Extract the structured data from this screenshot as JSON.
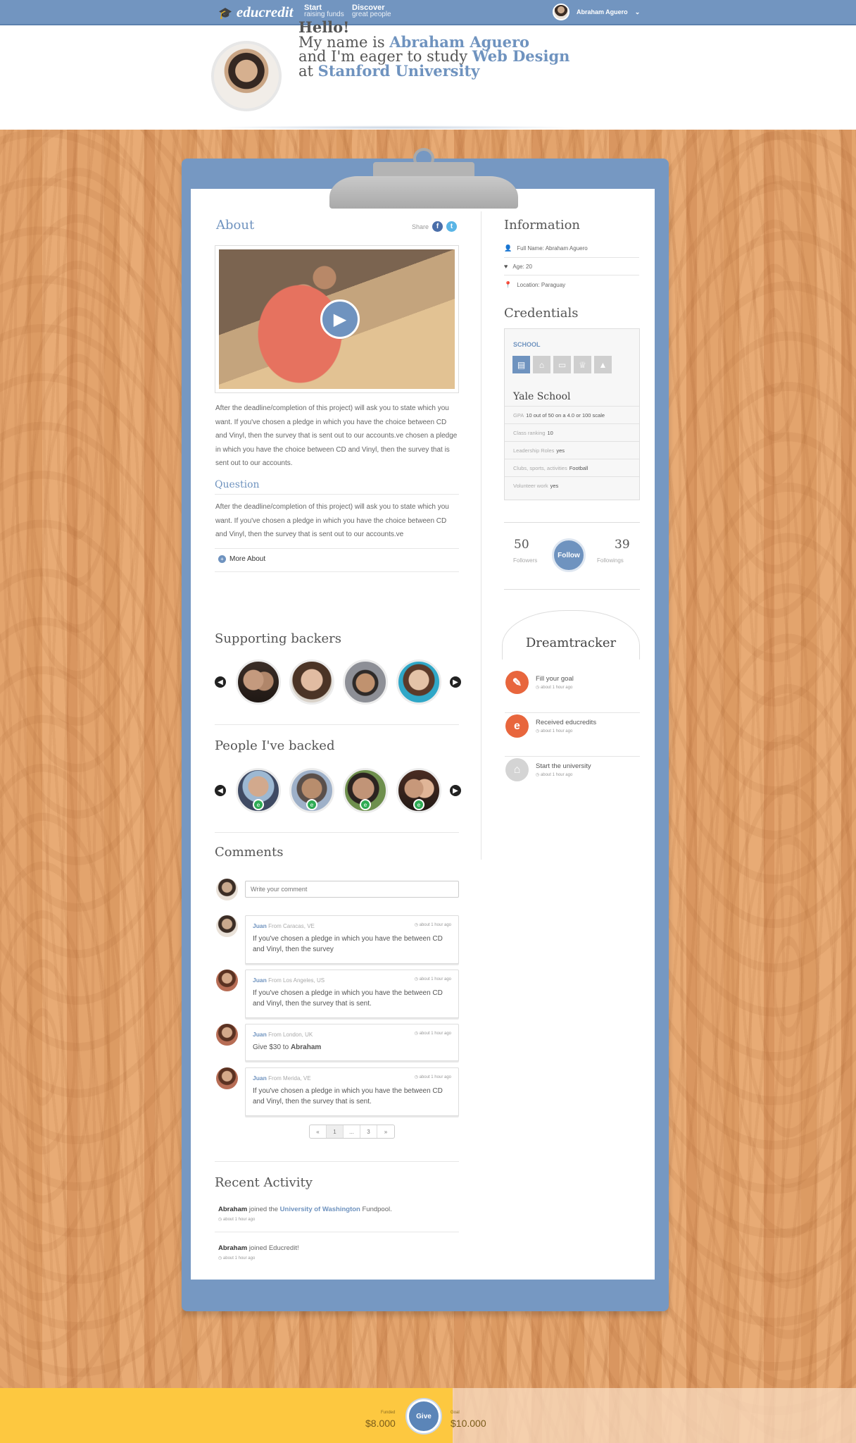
{
  "nav": {
    "logo": "educredit",
    "links": [
      {
        "title": "Start",
        "sub": "raising funds"
      },
      {
        "title": "Discover",
        "sub": "great people"
      }
    ],
    "user_name": "Abraham Aguero"
  },
  "header": {
    "greeting": "Hello!",
    "line1_prefix": "My name is",
    "name": "Abraham Aguero",
    "line2_prefix": "and I'm eager to study",
    "study": "Web Design",
    "line3_prefix": "at",
    "university": "Stanford University"
  },
  "about": {
    "title": "About",
    "share_label": "Share",
    "text": "After the deadline/completion of this project) will ask you to state which you want. If you've chosen a pledge in which you have the choice between CD and Vinyl, then the survey that is sent out to our accounts.ve chosen a pledge in which you have the choice between CD and Vinyl, then the survey that is sent out to our accounts.",
    "question_title": "Question",
    "question_text": "After the deadline/completion of this project) will ask you to state which you want. If you've chosen a pledge in which you have the choice between CD and Vinyl, then the survey that is sent out to our accounts.ve",
    "more_label": "More About"
  },
  "supporting": {
    "title": "Supporting backers"
  },
  "backed": {
    "title": "People I've backed"
  },
  "comments": {
    "title": "Comments",
    "placeholder": "Write your comment",
    "items": [
      {
        "author": "Juan",
        "from": "From Caracas, VE",
        "time": "about 1 hour ago",
        "text": "If you've chosen a pledge in which you have the between CD and Vinyl, then the survey"
      },
      {
        "author": "Juan",
        "from": "From Los Angeles, US",
        "time": "about 1 hour ago",
        "text": "If you've chosen a pledge in which you have the between CD and Vinyl, then the survey that is sent."
      },
      {
        "author": "Juan",
        "from": "From London, UK",
        "time": "about 1 hour ago",
        "text_prefix": "Give $30 to",
        "text_strong": "Abraham"
      },
      {
        "author": "Juan",
        "from": "From Merida, VE",
        "time": "about 1 hour ago",
        "text": "If you've chosen a pledge in which you have the between CD and Vinyl, then the survey that is sent."
      }
    ],
    "pager": [
      "«",
      "1",
      "...",
      "3",
      "»"
    ]
  },
  "recent": {
    "title": "Recent Activity",
    "items": [
      {
        "who": "Abraham",
        "verb": "joined the",
        "link": "University of Washington",
        "rest": "Fundpool.",
        "time": "about 1 hour ago"
      },
      {
        "who": "Abraham",
        "verb": "joined Educredit!",
        "time": "about 1 hour ago"
      }
    ]
  },
  "information": {
    "title": "Information",
    "full_name_label": "Full Name:",
    "full_name": "Abraham Aguero",
    "age_label": "Age:",
    "age": "20",
    "location_label": "Location:",
    "location": "Paraguay"
  },
  "credentials": {
    "title": "Credentials",
    "school_label": "SCHOOL",
    "school_name": "Yale School",
    "rows": [
      {
        "label": "GPA",
        "value": "10 out of 50 on a 4.0 or 100 scale"
      },
      {
        "label": "Class ranking",
        "value": "10"
      },
      {
        "label": "Leadership Roles",
        "value": "yes"
      },
      {
        "label": "Clubs, sports, activities",
        "value": "Football"
      },
      {
        "label": "Volunteer work",
        "value": "yes"
      }
    ]
  },
  "stats": {
    "followers": "50",
    "followers_label": "Followers",
    "followings": "39",
    "followings_label": "Followings",
    "follow_label": "Follow"
  },
  "dreamtracker": {
    "title": "Dreamtracker",
    "items": [
      {
        "title": "Fill your goal",
        "time": "about 1 hour ago",
        "color": "#e8663d"
      },
      {
        "title": "Received educredits",
        "time": "about 1 hour ago",
        "color": "#e8663d"
      },
      {
        "title": "Start the university",
        "time": "about 1 hour ago",
        "color": "#d4d4d4"
      }
    ]
  },
  "funding": {
    "funded_label": "Funded",
    "funded": "$8.000",
    "goal_label": "Goal",
    "goal": "$10.000",
    "give_label": "Give",
    "progress": 0.8
  },
  "colors": {
    "accent": "#6f93bf",
    "fund_yellow": "#fdc840",
    "orange": "#e8663d"
  }
}
